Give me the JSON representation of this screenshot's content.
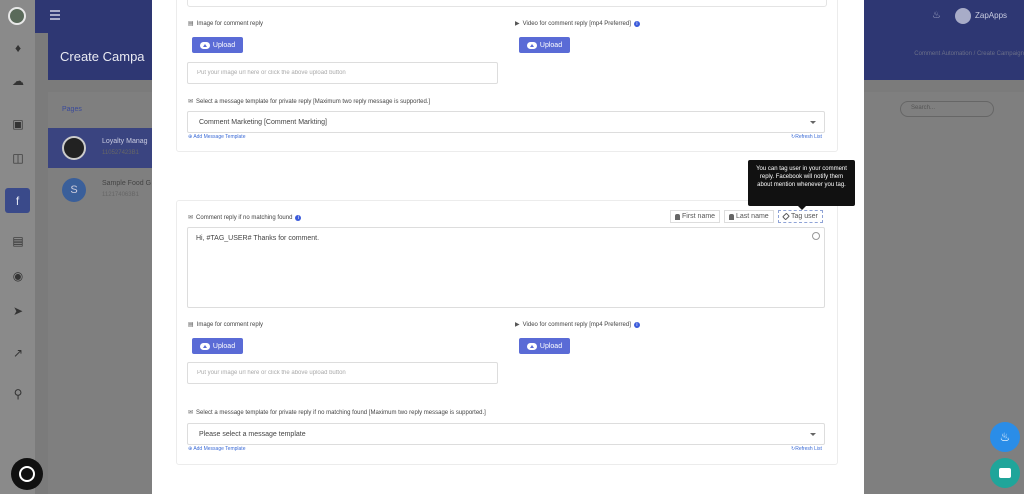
{
  "topbar": {
    "brand": "ZapApps"
  },
  "background": {
    "page_title": "Create Campa",
    "breadcrumb": "Comment Automation  /  Create Campaign",
    "pages_title": "Pages",
    "search_placeholder": "Search...",
    "pages": [
      {
        "name": "Loyalty Manag",
        "id": "110527423B1",
        "avatar_letter": ""
      },
      {
        "name": "Sample Food G",
        "id": "112174063B1",
        "avatar_letter": "S"
      }
    ]
  },
  "section1": {
    "image_label": "Image for comment reply",
    "video_label": "Video for comment reply [mp4 Preferred]",
    "upload_label": "Upload",
    "url_placeholder": "Put your image url here or click the above upload button",
    "template_label": "Select a message template for private reply [Maximum two reply message is supported.]",
    "template_value": "Comment Marketing [Comment Markting]",
    "add_template": "Add Message Template",
    "refresh_list": "Refresh List"
  },
  "section2": {
    "no_match_label": "Comment reply if no matching found",
    "first_name": "First name",
    "last_name": "Last name",
    "tag_user": "Tag user",
    "reply_text": "Hi, #TAG_USER# Thanks for comment.",
    "image_label": "Image for comment reply",
    "video_label": "Video for comment reply [mp4 Preferred]",
    "upload_label": "Upload",
    "url_placeholder": "Put your image url here or click the above upload button",
    "template_label": "Select a message template for private reply if no matching found [Maximum two reply message is supported.]",
    "template_value": "Please select a message template",
    "add_template": "Add Message Template",
    "refresh_list": "Refresh List"
  },
  "tooltip": {
    "text": "You can tag user in your comment reply. Facebook will notify them about mention whenever you tag."
  },
  "colors": {
    "accent": "#5a6bd6",
    "topbar": "#2e3773",
    "fab_bell": "#2a8de8",
    "fab_chat": "#1fa59a"
  }
}
